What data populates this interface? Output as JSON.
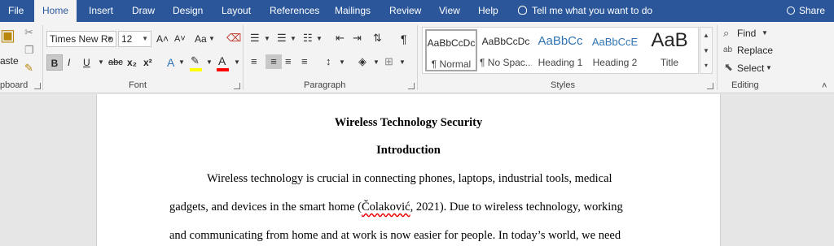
{
  "tabs": {
    "file": "File",
    "home": "Home",
    "insert": "Insert",
    "draw": "Draw",
    "design": "Design",
    "layout": "Layout",
    "references": "References",
    "mailings": "Mailings",
    "review": "Review",
    "view": "View",
    "help": "Help"
  },
  "tell_me": "Tell me what you want to do",
  "share": "Share",
  "clipboard": {
    "paste": "aste",
    "group_label": "pboard"
  },
  "font": {
    "name": "Times New Ro",
    "size": "12",
    "group_label": "Font",
    "bold": "B",
    "italic": "I",
    "underline": "U",
    "strike": "abc",
    "subscript": "x₂",
    "superscript": "x²",
    "grow": "A˄",
    "shrink": "A˅",
    "change_case": "Aa",
    "text_effects": "A",
    "font_color": "A"
  },
  "paragraph": {
    "group_label": "Paragraph",
    "pilcrow": "¶"
  },
  "styles": {
    "group_label": "Styles",
    "items": [
      {
        "sample": "AaBbCcDc",
        "name": "¶ Normal"
      },
      {
        "sample": "AaBbCcDc",
        "name": "¶ No Spac..."
      },
      {
        "sample": "AaBbCc",
        "name": "Heading 1"
      },
      {
        "sample": "AaBbCcE",
        "name": "Heading 2"
      },
      {
        "sample": "AaB",
        "name": "Title"
      }
    ]
  },
  "editing": {
    "group_label": "Editing",
    "find": "Find",
    "replace": "Replace",
    "select": "Select"
  },
  "document": {
    "title": "Wireless Technology Security",
    "section_heading": "Introduction",
    "line1": "Wireless technology is crucial in connecting phones, laptops, industrial tools, medical",
    "line2_before": "gadgets, and devices in the smart home (",
    "line2_author": "Čolaković",
    "line2_after": ", 2021). Due to wireless technology, working",
    "line3": "and communicating from home and at work is now easier for people. In today’s world, we need"
  },
  "colors": {
    "tabbar": "#2b579a",
    "ribbon": "#f3f3f3",
    "heading_style_blue": "#2e74b5",
    "highlight_yellow": "#ffff00",
    "font_color_red": "#ff0000"
  }
}
